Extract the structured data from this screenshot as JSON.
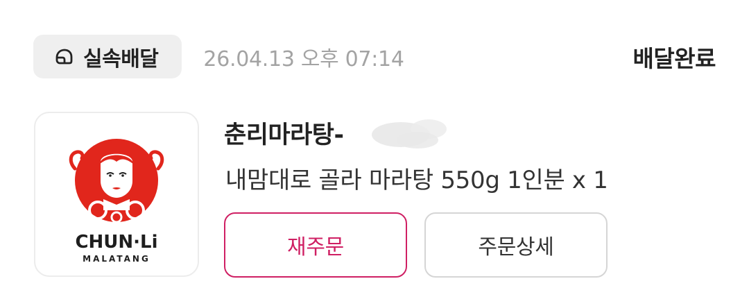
{
  "order": {
    "delivery_type": "실속배달",
    "delivery_type_icon": "helmet-icon",
    "date": "26.04.13 오후 07:14",
    "status": "배달완료"
  },
  "store": {
    "name": "춘리마라탕-",
    "name_redacted": true,
    "logo": {
      "brand_line1": "CHUN·Li",
      "brand_line2": "MALATANG"
    }
  },
  "item": {
    "description": "내맘대로 골라 마라탕 550g 1인분 x 1"
  },
  "actions": {
    "reorder_label": "재주문",
    "detail_label": "주문상세"
  },
  "colors": {
    "accent": "#cf1f63",
    "logo_red": "#e1261c",
    "chip_bg": "#efefef",
    "muted_text": "#a3a3a3"
  }
}
